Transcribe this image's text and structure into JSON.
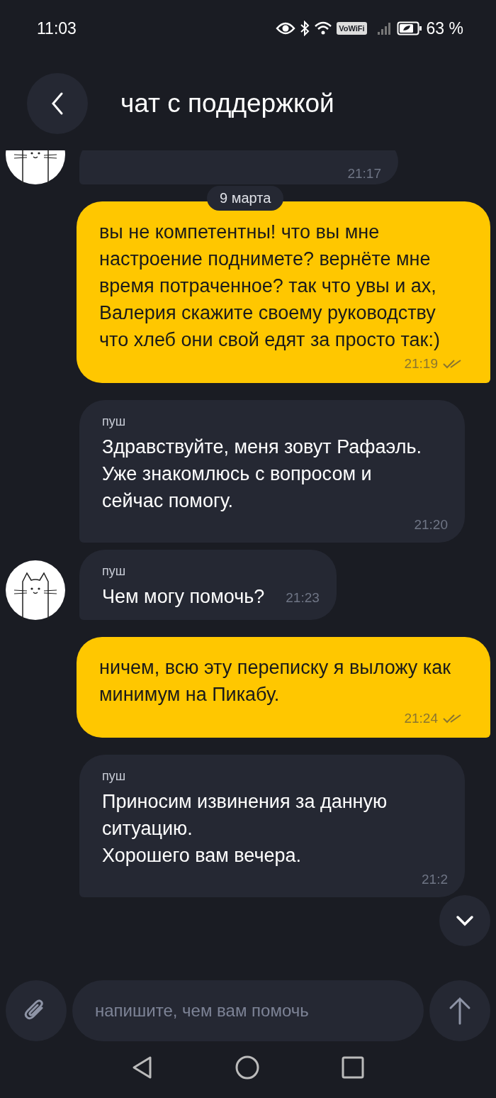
{
  "status_bar": {
    "time": "11:03",
    "wifi_badge": "VoWiFi",
    "battery": "63 %"
  },
  "header": {
    "title": "чат с поддержкой"
  },
  "date_label": "9 марта",
  "messages": [
    {
      "kind": "incoming",
      "avatar": true,
      "time": "21:17",
      "clipped": true
    },
    {
      "kind": "outgoing",
      "text": "вы не компетентны! что вы мне настроение поднимете? вернёте мне время потраченное? так что увы и ах, Валерия скажите своему руководству что хлеб они свой едят за просто так:)",
      "time": "21:19",
      "read": true
    },
    {
      "kind": "incoming",
      "avatar": false,
      "sender": "пуш",
      "text": "Здравствуйте, меня зовут Рафаэль.\nУже знакомлюсь с вопросом и\nсейчас помогу.",
      "time": "21:20"
    },
    {
      "kind": "incoming",
      "avatar": true,
      "inline_time": true,
      "sender": "пуш",
      "text": "Чем могу помочь?",
      "time": "21:23"
    },
    {
      "kind": "outgoing",
      "text": "ничем, всю эту переписку я выложу как минимум на Пикабу.",
      "time": "21:24",
      "read": true
    },
    {
      "kind": "incoming",
      "avatar": false,
      "sender": "пуш",
      "text": "Приносим извинения за данную ситуацию.\nХорошего вам вечера.",
      "time": "21:2"
    }
  ],
  "composer": {
    "placeholder": "напишите, чем вам помочь"
  }
}
